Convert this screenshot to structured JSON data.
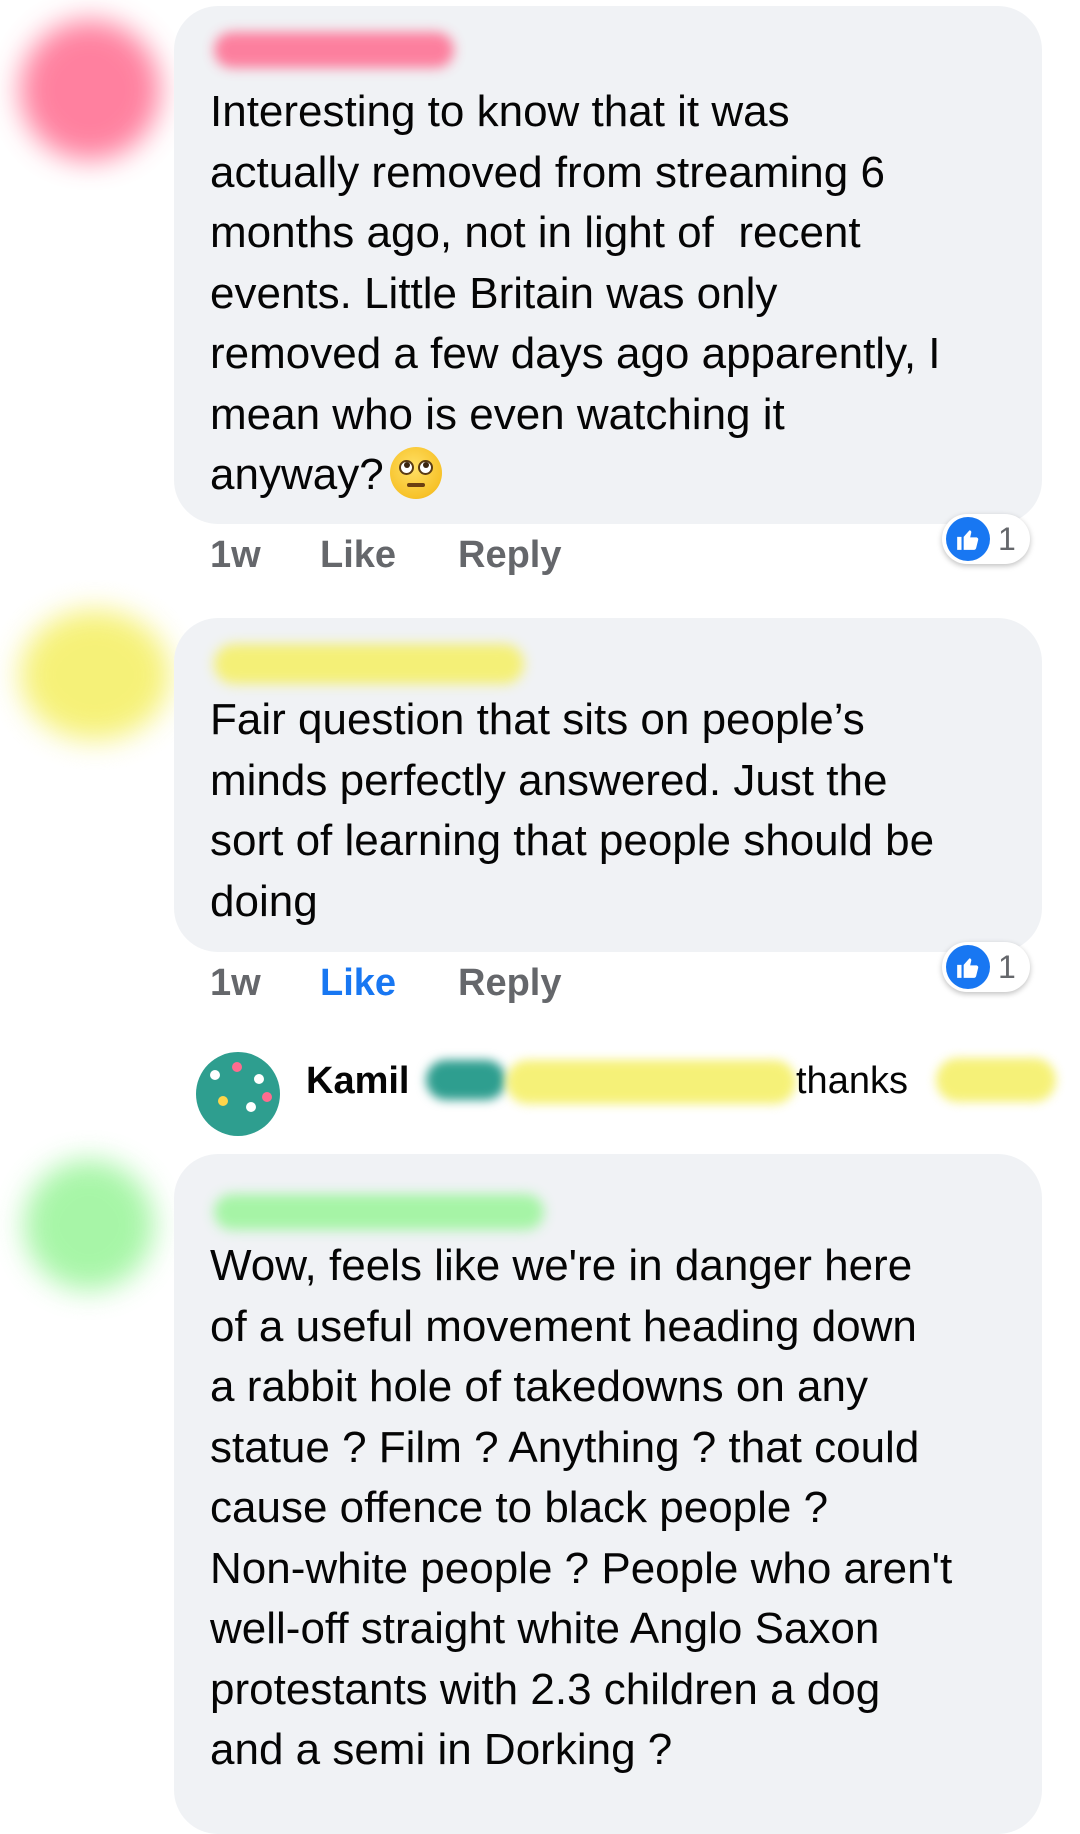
{
  "comments": [
    {
      "text": "Interesting to know that it was\nactually removed from streaming 6\nmonths ago, not in light of  recent\nevents. Little Britain was only\nremoved a few days ago apparently, I\nmean who is even watching it\nanyway?",
      "emoji": "face-with-rolling-eyes",
      "time": "1w",
      "like_label": "Like",
      "reply_label": "Reply",
      "reactions": "1",
      "liked": false,
      "avatar_color": "#ff6b8f"
    },
    {
      "text": "Fair question that sits on people’s\nminds perfectly answered. Just the\nsort of learning that people should be\ndoing",
      "time": "1w",
      "like_label": "Like",
      "reply_label": "Reply",
      "reactions": "1",
      "liked": true,
      "avatar_color": "#f5f06a"
    },
    {
      "text": "Wow, feels like we're in danger here\nof a useful movement heading down\na rabbit hole of takedowns on any\nstatue ? Film ? Anything ? that could\ncause offence to black people ?\nNon-white people ? People who aren't\nwell-off straight white Anglo Saxon\nprotestants with 2.3 children a dog\nand a semi in Dorking ?",
      "avatar_color": "#9ef59e"
    }
  ],
  "reply_preview": {
    "name": "Kamil",
    "text": "thanks"
  },
  "colors": {
    "like_active": "#1877f2",
    "bubble": "#f0f2f5",
    "meta": "#65676b"
  }
}
